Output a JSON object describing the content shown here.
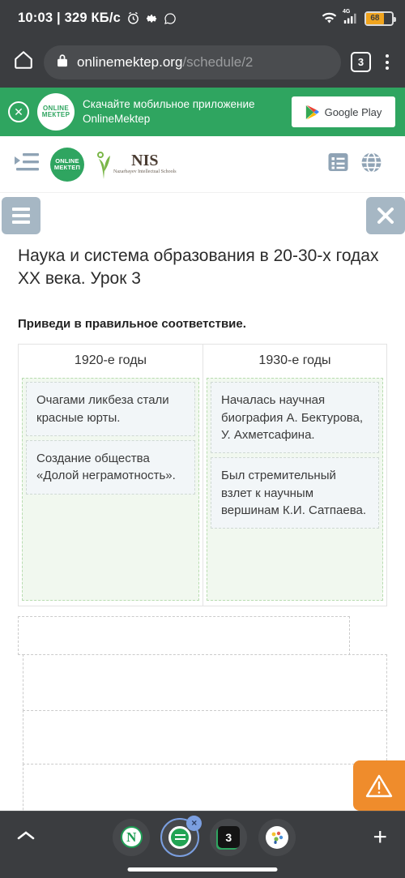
{
  "status_bar": {
    "time": "10:03",
    "separator": "|",
    "network_speed": "329 КБ/с",
    "icons": [
      "alarm-icon",
      "gear-icon",
      "whatsapp-icon"
    ],
    "wifi_icon": "wifi-icon",
    "network_type": "4G",
    "battery_percent": "68"
  },
  "browser": {
    "home_icon": "home-icon",
    "lock_icon": "lock-icon",
    "url_domain": "onlinemektep.org",
    "url_path": "/schedule/2",
    "tab_count": "3",
    "menu_icon": "overflow-menu-icon"
  },
  "app_banner": {
    "close_icon": "close-icon",
    "logo_line1": "ONLINE",
    "logo_line2": "МЕКТЕР",
    "text": "Скачайте мобильное приложение OnlineMektep",
    "store_button": "Google Play",
    "bg_color": "#2fa560"
  },
  "site_header": {
    "menu_icon": "indent-list-icon",
    "om_logo_line1": "ONLINE",
    "om_logo_line2": "МЕКТЕП",
    "nis_logo_text": "NIS",
    "nis_logo_subtitle": "Nazarbayev Intellectual Schools",
    "list_icon": "list-icon",
    "globe_icon": "globe-icon"
  },
  "toolbar": {
    "menu_icon": "hamburger-icon",
    "close_icon": "close-icon"
  },
  "lesson": {
    "title": "Наука и система образования в 20-30-х годах XX века. Урок 3",
    "prompt": "Приведи в правильное соответствие."
  },
  "match_table": {
    "columns": [
      {
        "header": "1920-е годы",
        "cards": [
          "Очагами ликбеза стали красные юрты.",
          "Создание общества «Долой неграмотность»."
        ]
      },
      {
        "header": "1930-е годы",
        "cards": [
          "Началась научная биография А. Бектурова, У. Ахметсафина.",
          "Был стремительный взлет к научным вершинам К.И. Сатпаева."
        ]
      }
    ]
  },
  "empty_dropzones": [
    "",
    "",
    "",
    ""
  ],
  "warning_button": {
    "icon": "warning-triangle-icon",
    "color": "#ef8c2c"
  },
  "tabbar": {
    "collapse_icon": "chevron-up-icon",
    "tabs": [
      {
        "name": "tab-n-app",
        "label": "N",
        "active": false
      },
      {
        "name": "tab-onlinemektep",
        "label": "",
        "active": true,
        "badge": "×"
      },
      {
        "name": "tab-three",
        "label": "3",
        "active": false
      },
      {
        "name": "tab-colorful-app",
        "label": "",
        "active": false
      }
    ],
    "add_icon": "plus-icon"
  }
}
